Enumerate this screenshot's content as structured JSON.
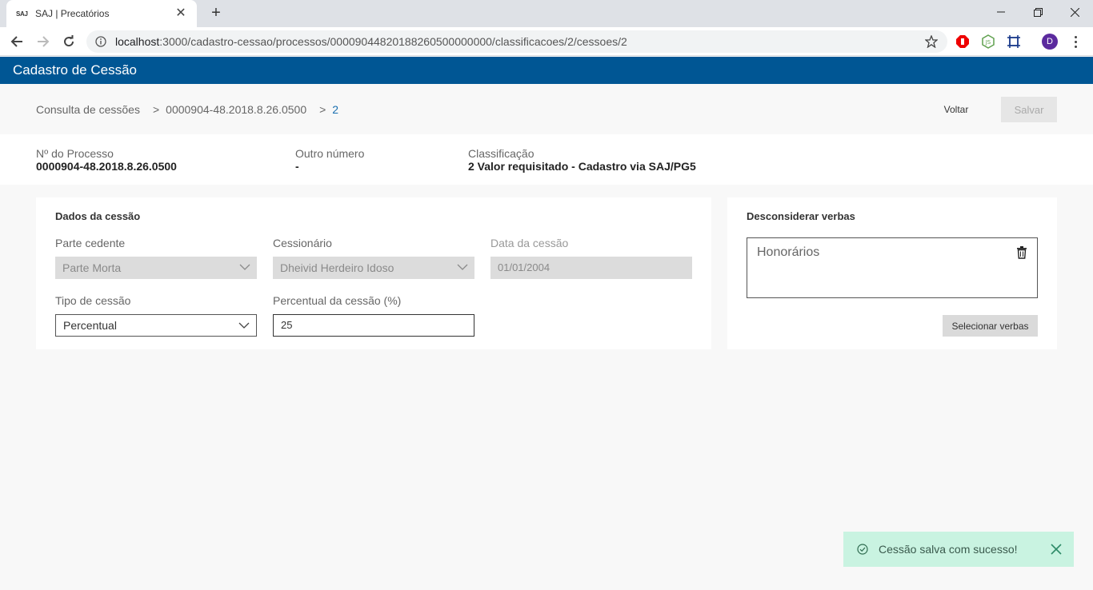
{
  "browser": {
    "tab_favicon": "SAJ",
    "tab_title": "SAJ | Precatórios",
    "url_host": "localhost",
    "url_path": ":3000/cadastro-cessao/processos/00009044820188260500000000/classificacoes/2/cessoes/2",
    "profile_initial": "D"
  },
  "app": {
    "title": "Cadastro de Cessão"
  },
  "breadcrumb": {
    "items": [
      "Consulta de cessões",
      "0000904-48.2018.8.26.0500",
      "2"
    ],
    "separator": ">"
  },
  "actions": {
    "voltar": "Voltar",
    "salvar": "Salvar"
  },
  "processo": {
    "numero_label": "Nº do Processo",
    "numero_value": "0000904-48.2018.8.26.0500",
    "outro_label": "Outro número",
    "outro_value": "-",
    "class_label": "Classificação",
    "class_value": "2 Valor requisitado - Cadastro via SAJ/PG5"
  },
  "dados": {
    "title": "Dados da cessão",
    "parte_label": "Parte cedente",
    "parte_value": "Parte Morta",
    "cessionario_label": "Cessionário",
    "cessionario_value": "Dheivid Herdeiro Idoso",
    "data_label": "Data da cessão",
    "data_value": "01/01/2004",
    "tipo_label": "Tipo de cessão",
    "tipo_value": "Percentual",
    "percentual_label": "Percentual da cessão (%)",
    "percentual_value": "25"
  },
  "verbas": {
    "title": "Desconsiderar verbas",
    "items": [
      "Honorários"
    ],
    "select_button": "Selecionar verbas"
  },
  "toast": {
    "message": "Cessão salva com sucesso!"
  },
  "colors": {
    "header": "#005694",
    "toast_bg": "#c9f3e1",
    "breadcrumb_active": "#1a6fb0"
  }
}
